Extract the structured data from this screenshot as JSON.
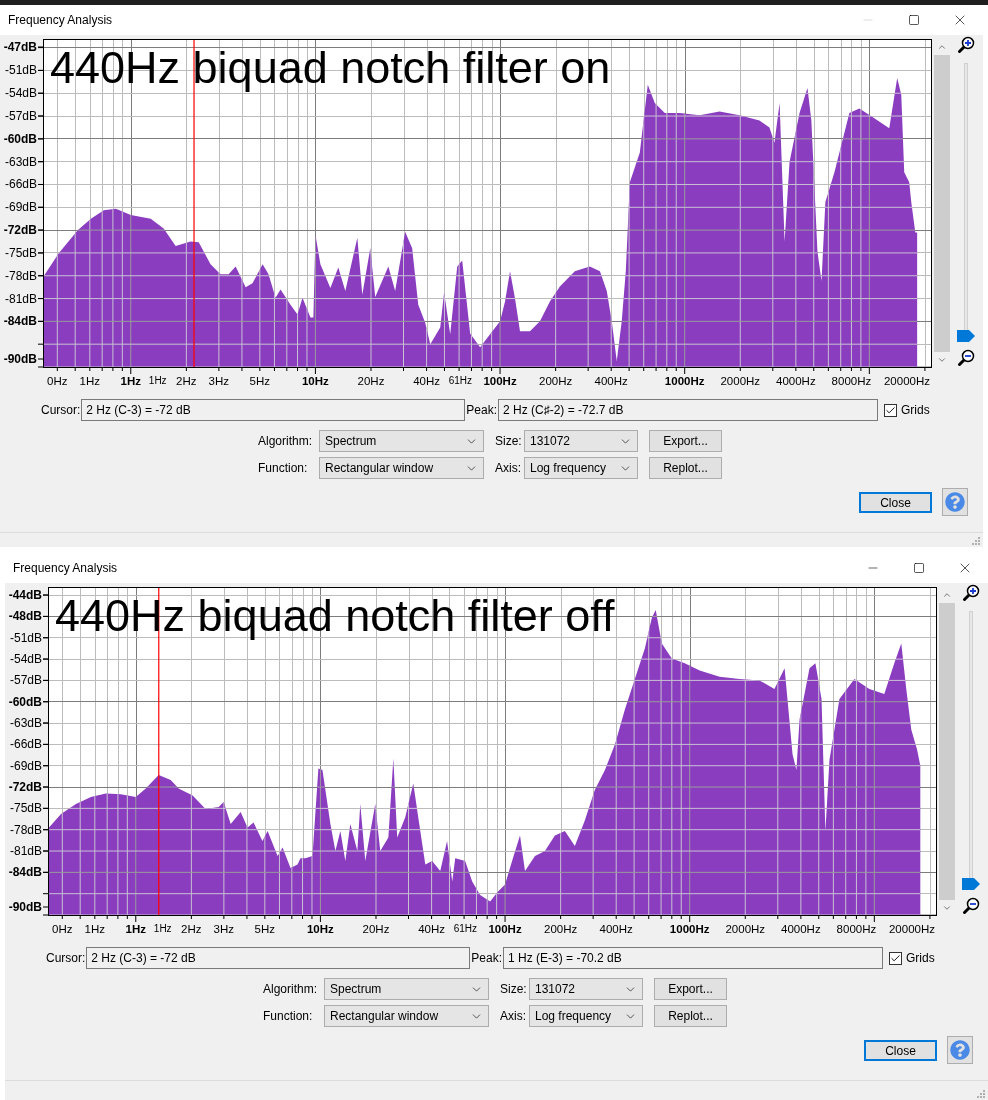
{
  "windows": [
    {
      "title": "Frequency Analysis",
      "minimize_button": {
        "disabled": true
      },
      "plot": {
        "kind": "notched",
        "caption": "440Hz biquad notch filter on",
        "y_labels": [
          {
            "text": "-47dB",
            "major": true
          },
          {
            "text": "-51dB",
            "major": false
          },
          {
            "text": "-54dB",
            "major": false
          },
          {
            "text": "-57dB",
            "major": false
          },
          {
            "text": "-60dB",
            "major": true
          },
          {
            "text": "-63dB",
            "major": false
          },
          {
            "text": "-66dB",
            "major": false
          },
          {
            "text": "-69dB",
            "major": false
          },
          {
            "text": "-72dB",
            "major": true
          },
          {
            "text": "-75dB",
            "major": false
          },
          {
            "text": "-78dB",
            "major": false
          },
          {
            "text": "-81dB",
            "major": false
          },
          {
            "text": "-84dB",
            "major": true
          },
          {
            "text": "-90dB",
            "major": true
          }
        ],
        "x_labels": [
          {
            "text": "0Hz",
            "major": false
          },
          {
            "text": "1Hz",
            "major": false
          },
          {
            "text": "1Hz",
            "major": true
          },
          {
            "text": "1Hz",
            "major": false
          },
          {
            "text": "2Hz",
            "major": false
          },
          {
            "text": "3Hz",
            "major": false
          },
          {
            "text": "5Hz",
            "major": false
          },
          {
            "text": "10Hz",
            "major": true
          },
          {
            "text": "20Hz",
            "major": false
          },
          {
            "text": "40Hz",
            "major": false
          },
          {
            "text": "61Hz",
            "major": false
          },
          {
            "text": "100Hz",
            "major": true
          },
          {
            "text": "200Hz",
            "major": false
          },
          {
            "text": "400Hz",
            "major": false
          },
          {
            "text": "1000Hz",
            "major": true
          },
          {
            "text": "2000Hz",
            "major": false
          },
          {
            "text": "4000Hz",
            "major": false
          },
          {
            "text": "8000Hz",
            "major": false
          },
          {
            "text": "20000Hz",
            "major": false
          }
        ]
      },
      "zoom_slider": {
        "level": 0
      },
      "cursor": {
        "label": "Cursor:",
        "value": "2 Hz (C-3) = -72 dB"
      },
      "peak": {
        "label": "Peak:",
        "value": "2 Hz (C♯-2) = -72.7 dB"
      },
      "grids": {
        "label": "Grids",
        "checked": true
      },
      "algorithm": {
        "label": "Algorithm:",
        "value": "Spectrum"
      },
      "size": {
        "label": "Size:",
        "value": "131072"
      },
      "export_button": "Export...",
      "function": {
        "label": "Function:",
        "value": "Rectangular window"
      },
      "axis": {
        "label": "Axis:",
        "value": "Log frequency"
      },
      "replot_button": "Replot...",
      "close_button": "Close"
    },
    {
      "title": "Frequency Analysis",
      "minimize_button": {
        "disabled": false
      },
      "plot": {
        "kind": "unfiltered",
        "caption": "440Hz biquad notch filter off",
        "y_labels": [
          {
            "text": "-44dB",
            "major": true
          },
          {
            "text": "-48dB",
            "major": true
          },
          {
            "text": "-51dB",
            "major": false
          },
          {
            "text": "-54dB",
            "major": false
          },
          {
            "text": "-57dB",
            "major": false
          },
          {
            "text": "-60dB",
            "major": true
          },
          {
            "text": "-63dB",
            "major": false
          },
          {
            "text": "-66dB",
            "major": false
          },
          {
            "text": "-69dB",
            "major": false
          },
          {
            "text": "-72dB",
            "major": true
          },
          {
            "text": "-75dB",
            "major": false
          },
          {
            "text": "-78dB",
            "major": false
          },
          {
            "text": "-81dB",
            "major": false
          },
          {
            "text": "-84dB",
            "major": true
          },
          {
            "text": "-90dB",
            "major": true
          }
        ],
        "x_labels": [
          {
            "text": "0Hz",
            "major": false
          },
          {
            "text": "1Hz",
            "major": false
          },
          {
            "text": "1Hz",
            "major": true
          },
          {
            "text": "1Hz",
            "major": false
          },
          {
            "text": "2Hz",
            "major": false
          },
          {
            "text": "3Hz",
            "major": false
          },
          {
            "text": "5Hz",
            "major": false
          },
          {
            "text": "10Hz",
            "major": true
          },
          {
            "text": "20Hz",
            "major": false
          },
          {
            "text": "40Hz",
            "major": false
          },
          {
            "text": "61Hz",
            "major": false
          },
          {
            "text": "100Hz",
            "major": true
          },
          {
            "text": "200Hz",
            "major": false
          },
          {
            "text": "400Hz",
            "major": false
          },
          {
            "text": "1000Hz",
            "major": true
          },
          {
            "text": "2000Hz",
            "major": false
          },
          {
            "text": "4000Hz",
            "major": false
          },
          {
            "text": "8000Hz",
            "major": false
          },
          {
            "text": "20000Hz",
            "major": false
          }
        ]
      },
      "zoom_slider": {
        "level": 0
      },
      "cursor": {
        "label": "Cursor:",
        "value": "2 Hz (C-3) = -72 dB"
      },
      "peak": {
        "label": "Peak:",
        "value": "1 Hz (E-3) = -70.2 dB"
      },
      "grids": {
        "label": "Grids",
        "checked": true
      },
      "algorithm": {
        "label": "Algorithm:",
        "value": "Spectrum"
      },
      "size": {
        "label": "Size:",
        "value": "131072"
      },
      "export_button": "Export...",
      "function": {
        "label": "Function:",
        "value": "Rectangular window"
      },
      "axis": {
        "label": "Axis:",
        "value": "Log frequency"
      },
      "replot_button": "Replot...",
      "close_button": "Close"
    }
  ]
}
